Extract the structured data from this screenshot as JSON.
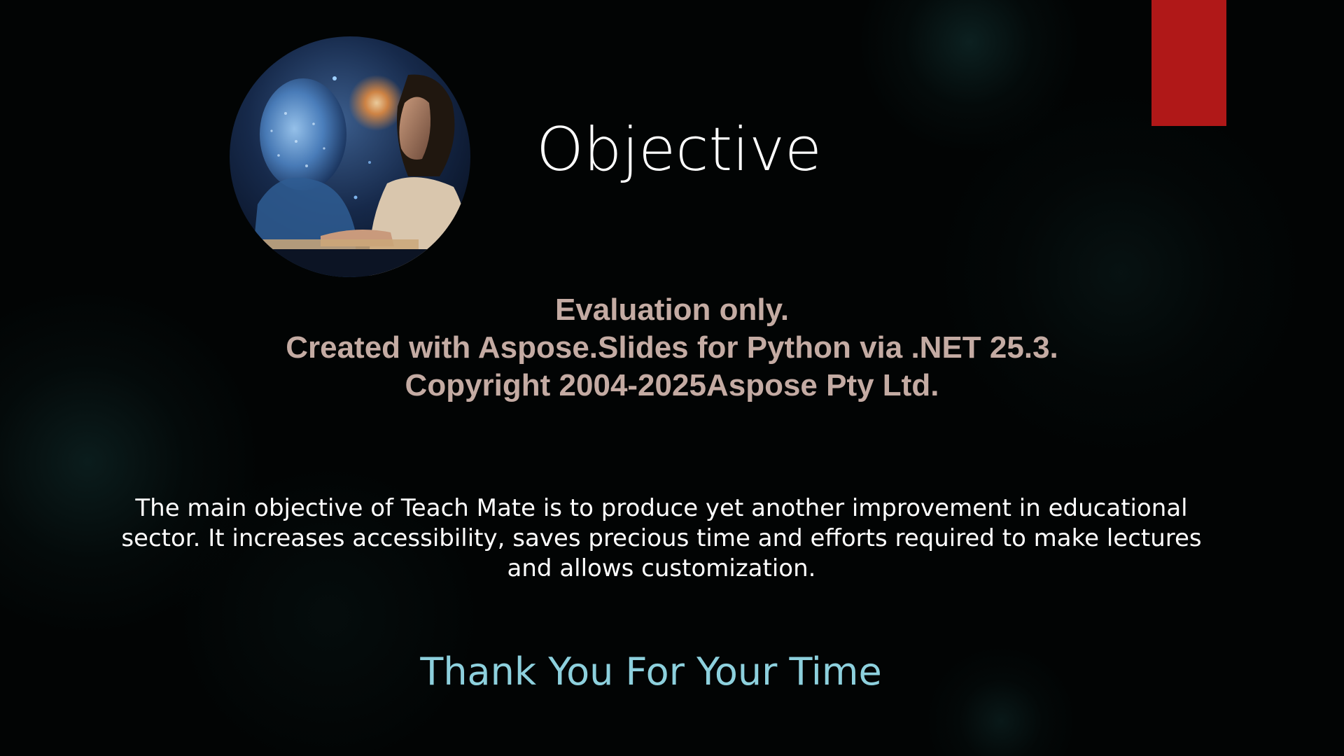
{
  "slide": {
    "title": "Objective",
    "watermark": {
      "line1": "Evaluation only.",
      "line2": "Created with Aspose.Slides for Python via .NET 25.3.",
      "line3": "Copyright 2004-2025Aspose Pty Ltd."
    },
    "body": "The main objective of Teach Mate is to produce yet another improvement in educational sector. It increases accessibility, saves precious time and efforts required to make lectures and allows customization.",
    "closing": "Thank You For Your Time"
  },
  "colors": {
    "background": "#020404",
    "accent_bar": "#b01818",
    "title": "#ffffff",
    "watermark": "#c4aba3",
    "body": "#ffffff",
    "closing": "#8dd0dd"
  },
  "icons": {
    "photo": "ai-robot-and-woman-at-laptop-image"
  }
}
